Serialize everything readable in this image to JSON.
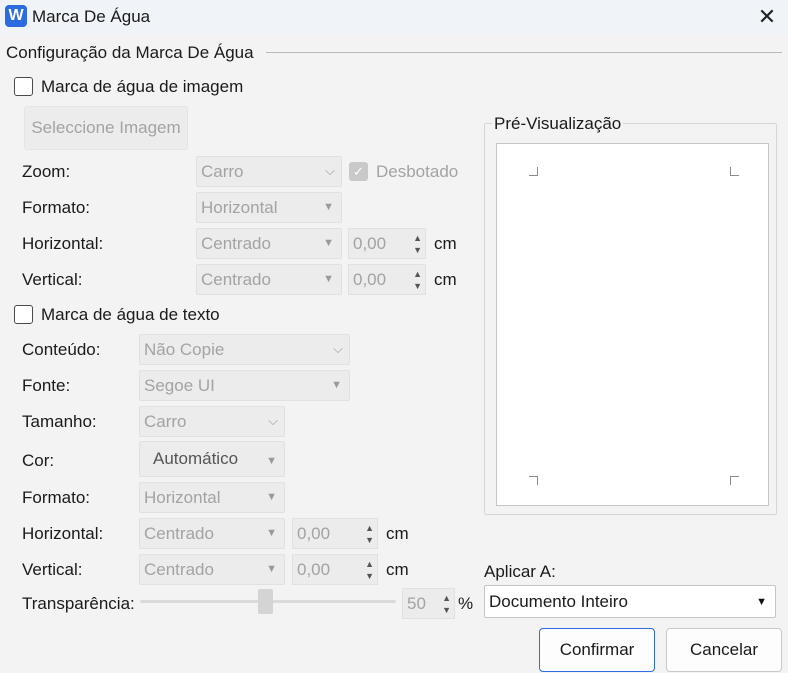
{
  "window": {
    "title": "Marca De Água",
    "app_icon_letter": "W"
  },
  "group_title": "Configuração da Marca De Água",
  "image_watermark": {
    "checkbox_label": "Marca de água de imagem",
    "checked": false,
    "select_image_button": "Seleccione Imagem",
    "zoom_label": "Zoom:",
    "zoom_value": "Carro",
    "washout_label": "Desbotado",
    "washout_checked": true,
    "format_label": "Formato:",
    "format_value": "Horizontal",
    "horizontal_label": "Horizontal:",
    "horizontal_align": "Centrado",
    "horizontal_offset": "0,00",
    "horizontal_unit": "cm",
    "vertical_label": "Vertical:",
    "vertical_align": "Centrado",
    "vertical_offset": "0,00",
    "vertical_unit": "cm"
  },
  "text_watermark": {
    "checkbox_label": "Marca de água de texto",
    "checked": false,
    "content_label": "Conteúdo:",
    "content_value": "Não Copie",
    "font_label": "Fonte:",
    "font_value": "Segoe UI",
    "size_label": "Tamanho:",
    "size_value": "Carro",
    "color_label": "Cor:",
    "color_value": "Automático",
    "format_label": "Formato:",
    "format_value": "Horizontal",
    "horizontal_label": "Horizontal:",
    "horizontal_align": "Centrado",
    "horizontal_offset": "0,00",
    "horizontal_unit": "cm",
    "vertical_label": "Vertical:",
    "vertical_align": "Centrado",
    "vertical_offset": "0,00",
    "vertical_unit": "cm",
    "transparency_label": "Transparência:",
    "transparency_value": "50",
    "transparency_unit": "%"
  },
  "preview": {
    "title": "Pré-Visualização"
  },
  "apply_to": {
    "label": "Aplicar A:",
    "value": "Documento Inteiro"
  },
  "buttons": {
    "confirm": "Confirmar",
    "cancel": "Cancelar"
  },
  "colors": {
    "accent": "#2d6be0",
    "disabled_text": "#a3a3a3",
    "background": "#f3f3f3"
  }
}
